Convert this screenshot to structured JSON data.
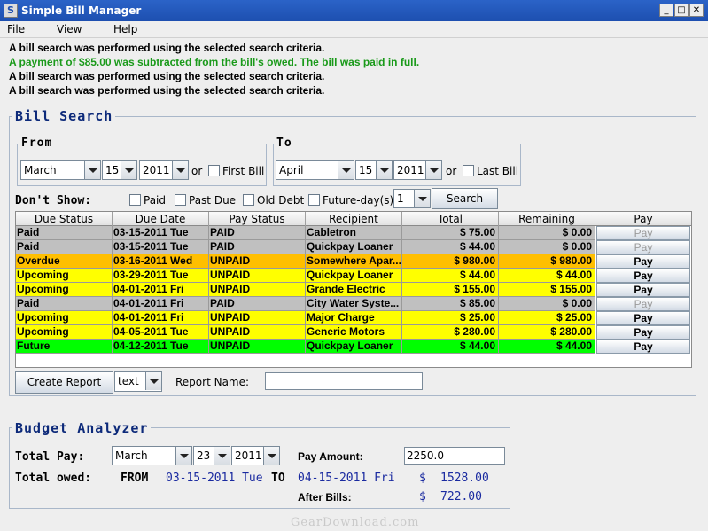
{
  "window": {
    "title": "Simple Bill Manager",
    "icon_label": "S",
    "min_glyph": "_",
    "max_glyph": "□",
    "close_glyph": "✕"
  },
  "menu": [
    "File",
    "View",
    "Help"
  ],
  "messages": [
    {
      "text": "A bill search was performed using the selected search criteria.",
      "color": "#000000"
    },
    {
      "text": "A payment of $85.00 was subtracted from the bill's owed. The bill was paid in full.",
      "color": "#1a9a1a"
    },
    {
      "text": "A bill search was performed using the selected search criteria.",
      "color": "#000000"
    },
    {
      "text": "A bill search was performed using the selected search criteria.",
      "color": "#000000"
    }
  ],
  "bill_search": {
    "title": "Bill Search",
    "from": {
      "label": "From",
      "month": "March",
      "day": "15",
      "year": "2011",
      "or": "or",
      "first_bill": "First Bill"
    },
    "to": {
      "label": "To",
      "month": "April",
      "day": "15",
      "year": "2011",
      "or": "or",
      "last_bill": "Last Bill"
    },
    "dont_show": {
      "label": "Don't Show:",
      "paid": "Paid",
      "past_due": "Past Due",
      "old_debt": "Old Debt",
      "future": "Future-day(s)",
      "future_days": "1"
    },
    "search_button": "Search"
  },
  "table": {
    "columns": [
      "Due Status",
      "Due Date",
      "Pay Status",
      "Recipient",
      "Total",
      "Remaining",
      "Pay"
    ],
    "rows": [
      {
        "status": "Paid",
        "date": "03-15-2011 Tue",
        "pay_status": "PAID",
        "recipient": "Cabletron",
        "total": "$  75.00",
        "remaining": "$  0.00",
        "pay": "Pay",
        "color": "#c0c0c0",
        "pay_enabled": false
      },
      {
        "status": "Paid",
        "date": "03-15-2011 Tue",
        "pay_status": "PAID",
        "recipient": "Quickpay Loaner",
        "total": "$  44.00",
        "remaining": "$  0.00",
        "pay": "Pay",
        "color": "#c0c0c0",
        "pay_enabled": false
      },
      {
        "status": "Overdue",
        "date": "03-16-2011 Wed",
        "pay_status": "UNPAID",
        "recipient": "Somewhere Apar...",
        "total": "$  980.00",
        "remaining": "$  980.00",
        "pay": "Pay",
        "color": "#ffbf00",
        "pay_enabled": true
      },
      {
        "status": "Upcoming",
        "date": "03-29-2011 Tue",
        "pay_status": "UNPAID",
        "recipient": "Quickpay Loaner",
        "total": "$  44.00",
        "remaining": "$  44.00",
        "pay": "Pay",
        "color": "#ffff00",
        "pay_enabled": true
      },
      {
        "status": "Upcoming",
        "date": "04-01-2011 Fri",
        "pay_status": "UNPAID",
        "recipient": "Grande Electric",
        "total": "$  155.00",
        "remaining": "$  155.00",
        "pay": "Pay",
        "color": "#ffff00",
        "pay_enabled": true
      },
      {
        "status": "Paid",
        "date": "04-01-2011 Fri",
        "pay_status": "PAID",
        "recipient": "City Water Syste...",
        "total": "$  85.00",
        "remaining": "$  0.00",
        "pay": "Pay",
        "color": "#c0c0c0",
        "pay_enabled": false
      },
      {
        "status": "Upcoming",
        "date": "04-01-2011 Fri",
        "pay_status": "UNPAID",
        "recipient": "Major Charge",
        "total": "$  25.00",
        "remaining": "$  25.00",
        "pay": "Pay",
        "color": "#ffff00",
        "pay_enabled": true
      },
      {
        "status": "Upcoming",
        "date": "04-05-2011 Tue",
        "pay_status": "UNPAID",
        "recipient": "Generic Motors",
        "total": "$  280.00",
        "remaining": "$  280.00",
        "pay": "Pay",
        "color": "#ffff00",
        "pay_enabled": true
      },
      {
        "status": "Future",
        "date": "04-12-2011 Tue",
        "pay_status": "UNPAID",
        "recipient": "Quickpay Loaner",
        "total": "$  44.00",
        "remaining": "$  44.00",
        "pay": "Pay",
        "color": "#00ff00",
        "pay_enabled": true
      }
    ]
  },
  "report": {
    "create_button": "Create Report",
    "format": "text",
    "name_label": "Report Name:",
    "name_value": ""
  },
  "budget": {
    "title": "Budget Analyzer",
    "total_pay_label": "Total Pay:",
    "month": "March",
    "day": "23",
    "year": "2011",
    "pay_amount_label": "Pay Amount:",
    "pay_amount_value": "2250.0",
    "total_owed_label": "Total owed:",
    "from_label": "FROM",
    "from_date": "03-15-2011 Tue",
    "to_label": "TO",
    "to_date": "04-15-2011 Fri",
    "owed_currency": "$",
    "owed_amount": "1528.00",
    "after_bills_label": "After Bills:",
    "after_currency": "$",
    "after_amount": "722.00"
  },
  "watermark": "GearDownload.com"
}
